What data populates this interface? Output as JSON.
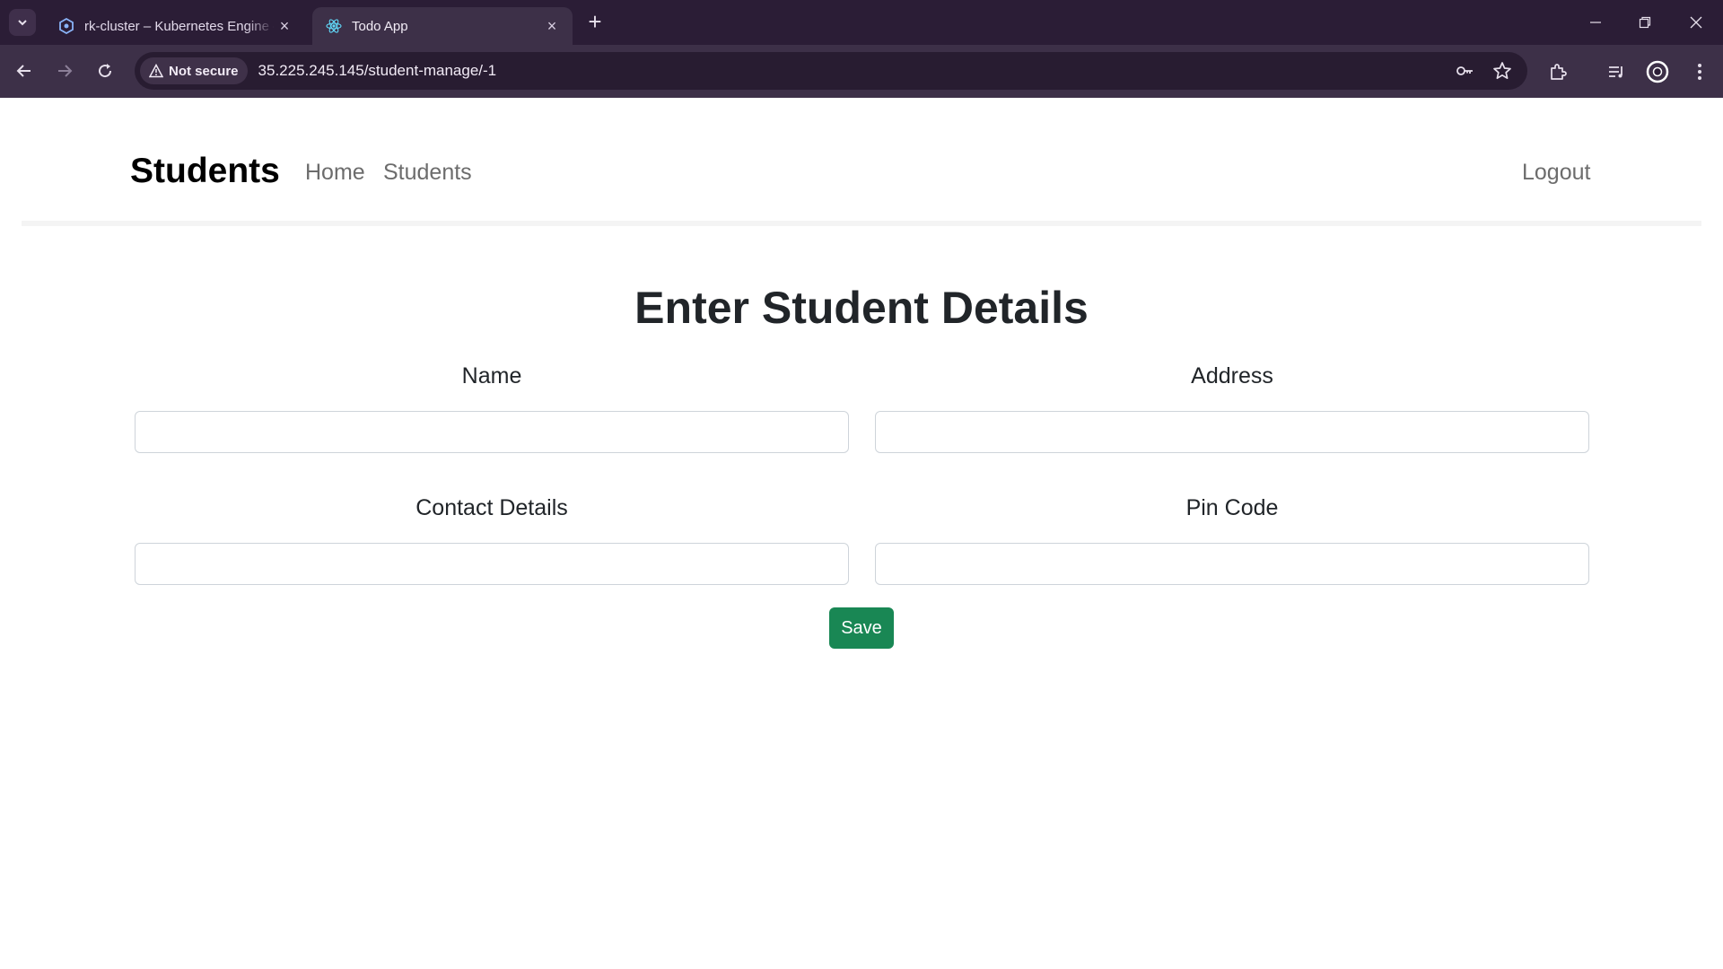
{
  "browser": {
    "tabs": [
      {
        "title": "rk-cluster – Kubernetes Engine – ",
        "favicon": "kubernetes-engine-icon",
        "active": false
      },
      {
        "title": "Todo App",
        "favicon": "react-icon",
        "active": true
      }
    ],
    "security_label": "Not secure",
    "url": "35.225.245.145/student-manage/-1"
  },
  "navbar": {
    "brand": "Students",
    "links": [
      "Home",
      "Students"
    ],
    "logout": "Logout"
  },
  "form": {
    "heading": "Enter Student Details",
    "fields": [
      {
        "label": "Name",
        "value": ""
      },
      {
        "label": "Address",
        "value": ""
      },
      {
        "label": "Contact Details",
        "value": ""
      },
      {
        "label": "Pin Code",
        "value": ""
      }
    ],
    "save_label": "Save"
  },
  "colors": {
    "chrome_dark": "#2b1d36",
    "chrome_toolbar": "#3d3048",
    "save_button": "#198754",
    "heading_text": "#212529"
  }
}
